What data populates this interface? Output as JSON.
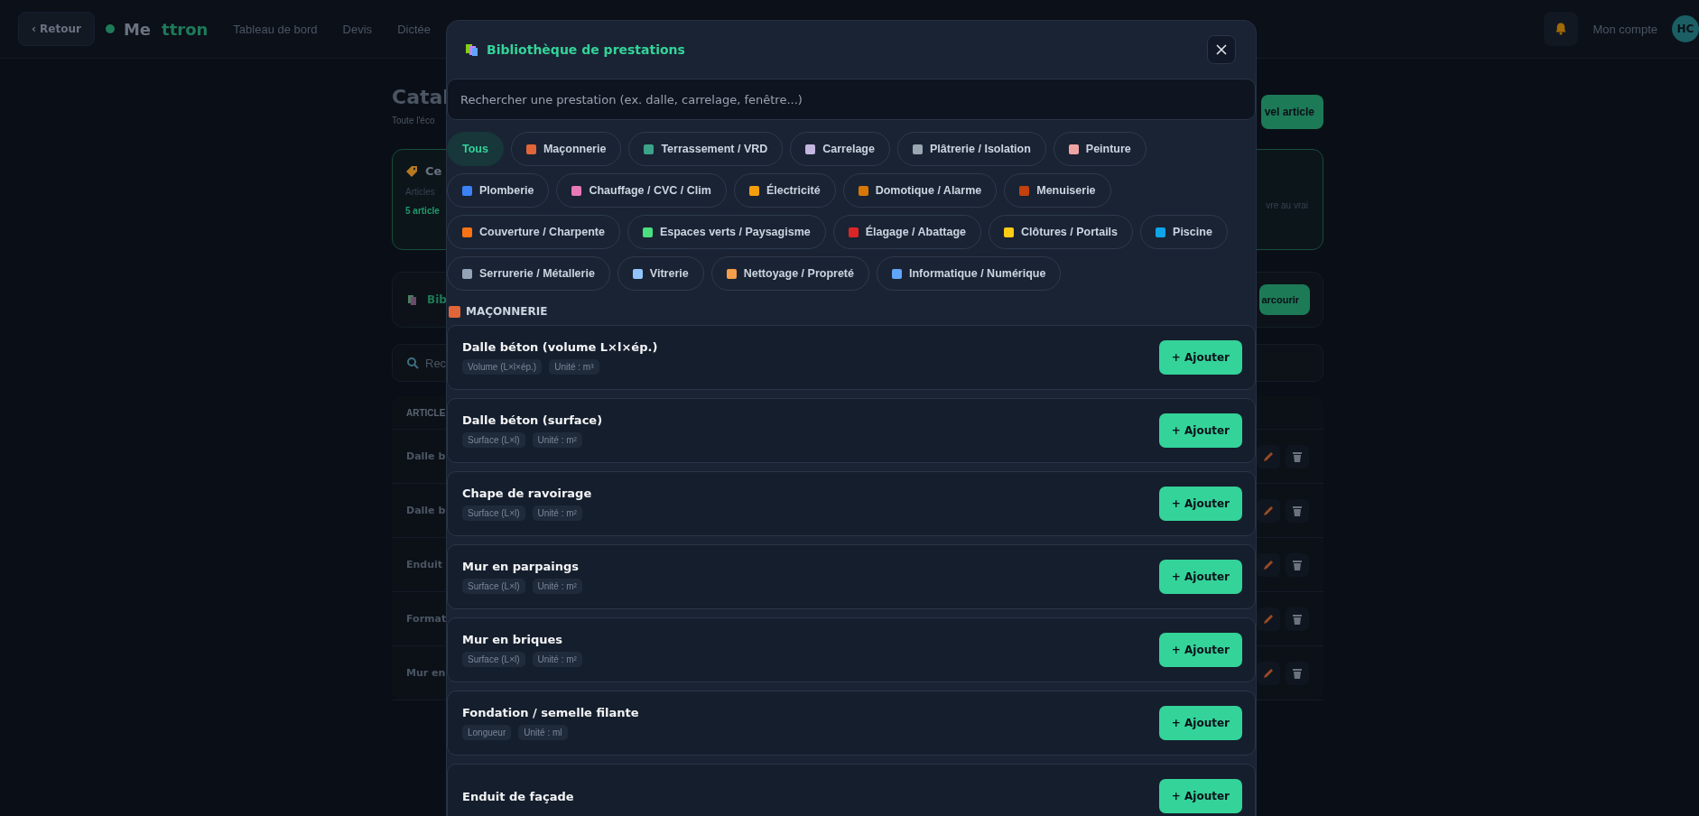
{
  "topbar": {
    "back_button": "‹ Retour",
    "logo": {
      "part_1": "Me",
      "part_2": "ttron"
    },
    "nav": [
      {
        "label": "Tableau de bord"
      },
      {
        "label": "Devis"
      },
      {
        "label": "Dictée"
      }
    ],
    "account": "Mon compte",
    "avatar": "HC"
  },
  "page": {
    "title": "Catal",
    "subtitle": "Toute l'éco",
    "new_button": "vel article",
    "card": {
      "title": "Ce",
      "text": "Articles",
      "count": "5 article",
      "right_text": "vre au vrai"
    },
    "library_card": {
      "title": "Bib",
      "button": "arcourir"
    },
    "search": {
      "placeholder": "Rec"
    },
    "table": {
      "header": "ARTICLE",
      "rows": [
        "Dalle b",
        "Dalle b",
        "Enduit",
        "Format",
        "Mur en"
      ]
    }
  },
  "modal": {
    "title": "Bibliothèque de prestations",
    "search": {
      "placeholder": "Rechercher une prestation (ex. dalle, carrelage, fenêtre...)"
    },
    "chips": [
      {
        "label": "Tous",
        "selected": true
      },
      {
        "label": "Maçonnerie",
        "selected": false,
        "color": "#e0663a"
      },
      {
        "label": "Terrassement / VRD",
        "selected": false,
        "color": "#3aa38a"
      },
      {
        "label": "Carrelage",
        "selected": false,
        "color": "#c4b5e0"
      },
      {
        "label": "Plâtrerie / Isolation",
        "selected": false,
        "color": "#9aa6b2"
      },
      {
        "label": "Peinture",
        "selected": false,
        "color": "#f0a3a3"
      },
      {
        "label": "Plomberie",
        "selected": false,
        "color": "#3b82f6"
      },
      {
        "label": "Chauffage / CVC / Clim",
        "selected": false,
        "color": "#e879b8"
      },
      {
        "label": "Électricité",
        "selected": false,
        "color": "#f59e0b"
      },
      {
        "label": "Domotique / Alarme",
        "selected": false,
        "color": "#d97706"
      },
      {
        "label": "Menuiserie",
        "selected": false,
        "color": "#c2410c"
      },
      {
        "label": "Couverture / Charpente",
        "selected": false,
        "color": "#f97316"
      },
      {
        "label": "Espaces verts / Paysagisme",
        "selected": false,
        "color": "#4ade80"
      },
      {
        "label": "Élagage / Abattage",
        "selected": false,
        "color": "#dc2626"
      },
      {
        "label": "Clôtures / Portails",
        "selected": false,
        "color": "#facc15"
      },
      {
        "label": "Piscine",
        "selected": false,
        "color": "#0ea5e9"
      },
      {
        "label": "Serrurerie / Métallerie",
        "selected": false,
        "color": "#94a3b8"
      },
      {
        "label": "Vitrerie",
        "selected": false,
        "color": "#93c5fd"
      },
      {
        "label": "Nettoyage / Propreté",
        "selected": false,
        "color": "#f59e4b"
      },
      {
        "label": "Informatique / Numérique",
        "selected": false,
        "color": "#60a5fa"
      }
    ],
    "section": {
      "title": "MAÇONNERIE",
      "color": "#e0663a"
    },
    "items": [
      {
        "name": "Dalle béton (volume L×l×ép.)",
        "tags": [
          "Volume (L×l×ép.)",
          "Unité : m³"
        ],
        "button": "+ Ajouter"
      },
      {
        "name": "Dalle béton (surface)",
        "tags": [
          "Surface (L×l)",
          "Unité : m²"
        ],
        "button": "+ Ajouter"
      },
      {
        "name": "Chape de ravoirage",
        "tags": [
          "Surface (L×l)",
          "Unité : m²"
        ],
        "button": "+ Ajouter"
      },
      {
        "name": "Mur en parpaings",
        "tags": [
          "Surface (L×l)",
          "Unité : m²"
        ],
        "button": "+ Ajouter"
      },
      {
        "name": "Mur en briques",
        "tags": [
          "Surface (L×l)",
          "Unité : m²"
        ],
        "button": "+ Ajouter"
      },
      {
        "name": "Fondation / semelle filante",
        "tags": [
          "Longueur",
          "Unité : ml"
        ],
        "button": "+ Ajouter"
      },
      {
        "name": "Enduit de façade",
        "button": "+ Ajouter"
      }
    ]
  }
}
